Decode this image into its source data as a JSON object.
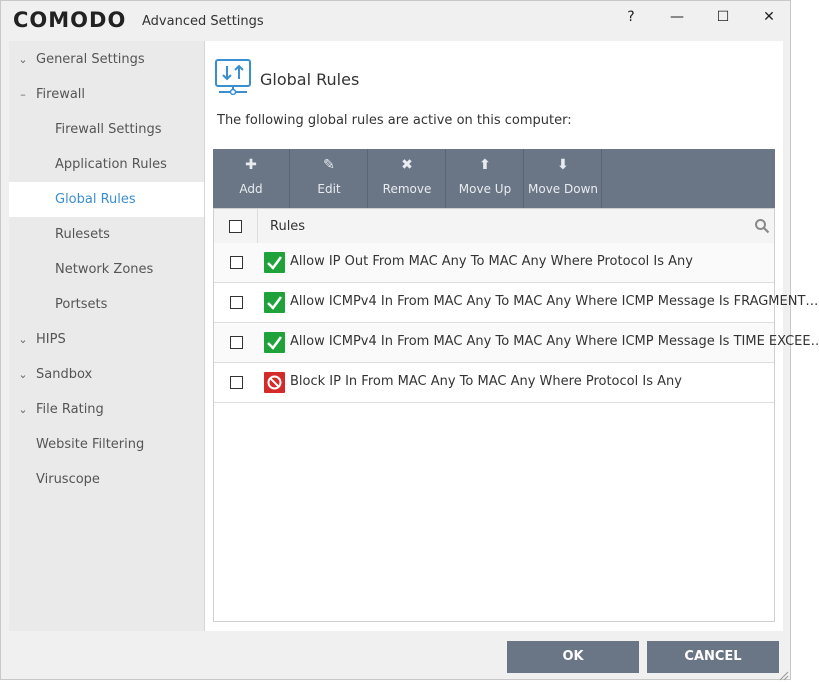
{
  "window": {
    "logo": "COMODO",
    "subtitle": "Advanced Settings",
    "controls": {
      "help": "?",
      "minimize": "—",
      "maximize": "☐",
      "close": "✕"
    }
  },
  "sidebar": {
    "items": [
      {
        "label": "General Settings",
        "arrow": "⌄"
      },
      {
        "label": "Firewall",
        "arrow": "–"
      },
      {
        "label": "Firewall Settings"
      },
      {
        "label": "Application Rules"
      },
      {
        "label": "Global Rules"
      },
      {
        "label": "Rulesets"
      },
      {
        "label": "Network Zones"
      },
      {
        "label": "Portsets"
      },
      {
        "label": "HIPS",
        "arrow": "⌄"
      },
      {
        "label": "Sandbox",
        "arrow": "⌄"
      },
      {
        "label": "File Rating",
        "arrow": "⌄"
      },
      {
        "label": "Website Filtering"
      },
      {
        "label": "Viruscope"
      }
    ]
  },
  "main": {
    "title": "Global Rules",
    "description": "The following global rules are active on this computer:",
    "toolbar": [
      {
        "label": "Add",
        "icon": "✚"
      },
      {
        "label": "Edit",
        "icon": "✎"
      },
      {
        "label": "Remove",
        "icon": "✖"
      },
      {
        "label": "Move Up",
        "icon": "⬆"
      },
      {
        "label": "Move Down",
        "icon": "⬇"
      }
    ],
    "grid": {
      "column": "Rules",
      "rows": [
        {
          "status": "allow",
          "text": "Allow IP Out From MAC Any To MAC Any Where Protocol Is Any"
        },
        {
          "status": "allow",
          "text": "Allow ICMPv4 In From MAC Any To MAC Any Where ICMP Message Is FRAGMENT…"
        },
        {
          "status": "allow",
          "text": "Allow ICMPv4 In From MAC Any To MAC Any Where ICMP Message Is TIME EXCEE…"
        },
        {
          "status": "block",
          "text": "Block IP In From MAC Any To MAC Any Where Protocol Is Any"
        }
      ]
    }
  },
  "footer": {
    "ok": "OK",
    "cancel": "CANCEL"
  },
  "colors": {
    "accent": "#3a8fd0",
    "toolbar": "#6a7585",
    "allow": "#1fa23a",
    "block": "#d42a2a"
  }
}
